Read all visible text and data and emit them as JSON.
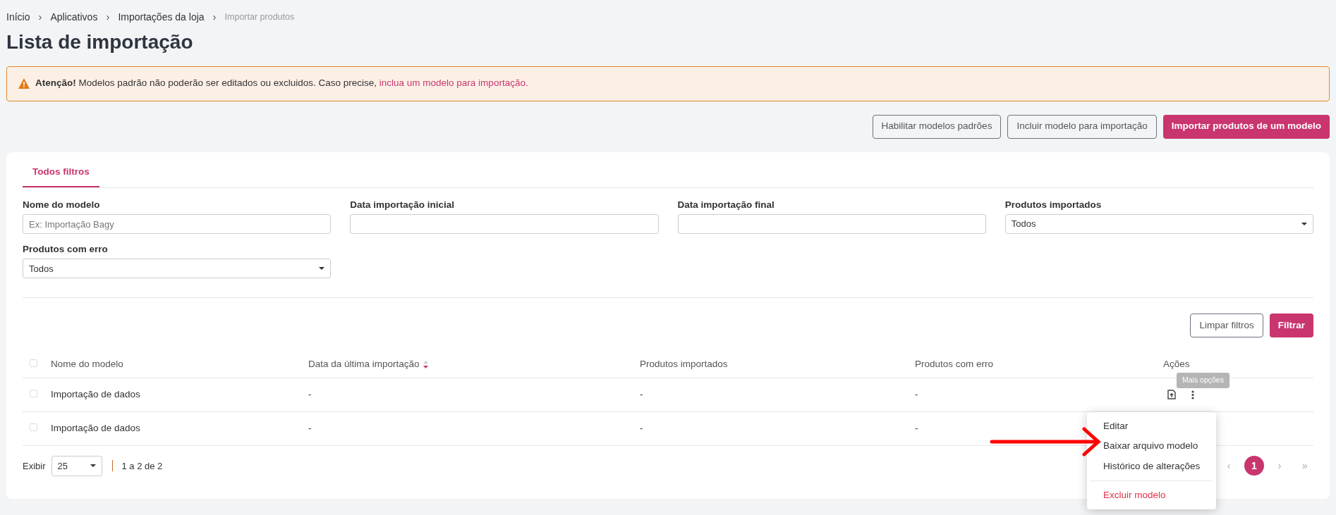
{
  "breadcrumb": [
    {
      "label": "Início",
      "current": false
    },
    {
      "label": "Aplicativos",
      "current": false
    },
    {
      "label": "Importações da loja",
      "current": false
    },
    {
      "label": "Importar produtos",
      "current": true
    }
  ],
  "breadcrumb_separator": "›",
  "page_title": "Lista de importação",
  "alert": {
    "text": "**Atenção!** Modelos padrão não poderão ser editados ou excluidos. Caso precise,",
    "link": "inclua um modelo para importação."
  },
  "header_buttons": [
    {
      "label": "Habilitar modelos padrões",
      "kind": "outline"
    },
    {
      "label": "Incluir modelo para importação",
      "kind": "outline"
    },
    {
      "label": "Importar produtos de um modelo",
      "kind": "primary"
    }
  ],
  "tabs": [
    {
      "label": "Todos filtros",
      "selected": true
    }
  ],
  "filters": [
    {
      "label": "Nome do modelo",
      "kind": "text",
      "placeholder": "Ex: Importação Bagy"
    },
    {
      "label": "Data importação inicial",
      "kind": "text"
    },
    {
      "label": "Data importação final",
      "kind": "text"
    },
    {
      "label": "Produtos importados",
      "kind": "select",
      "value": "Todos"
    },
    {
      "label": "Produtos com erro",
      "kind": "select",
      "value": "Todos"
    }
  ],
  "filter_buttons": [
    {
      "label": "Limpar filtros",
      "kind": "outline"
    },
    {
      "label": "Filtrar",
      "kind": "primary"
    }
  ],
  "table": {
    "select_all": {
      "checked": false
    },
    "columns": [
      {
        "label": "Nome do modelo",
        "sortable": false
      },
      {
        "label": "Data da última importação",
        "sortable": true
      },
      {
        "label": "Produtos importados",
        "sortable": false
      },
      {
        "label": "Produtos com erro",
        "sortable": false
      },
      {
        "label": "Ações",
        "sortable": false
      }
    ],
    "rows": [
      {
        "checked": false,
        "cells": [
          "Importação de dados",
          "-",
          "-",
          "-"
        ],
        "actions": true
      },
      {
        "checked": false,
        "cells": [
          "Importação de dados",
          "-",
          "-",
          "-"
        ],
        "actions": false
      }
    ]
  },
  "tooltip": "Mais opções",
  "menu": [
    {
      "label": "Editar",
      "kind": "normal"
    },
    {
      "label": "Baixar arquivo modelo",
      "kind": "normal"
    },
    {
      "label": "Histórico de alterações",
      "kind": "normal"
    },
    {
      "label": "Excluir modelo",
      "kind": "danger"
    }
  ],
  "footer": {
    "show_label": "Exibir",
    "page_size": "25",
    "range": "1 a 2 de 2"
  },
  "pagination": [
    {
      "label": "‹",
      "selected": false
    },
    {
      "label": "1",
      "selected": true
    },
    {
      "label": "›",
      "selected": false
    },
    {
      "label": "»",
      "selected": false
    }
  ]
}
